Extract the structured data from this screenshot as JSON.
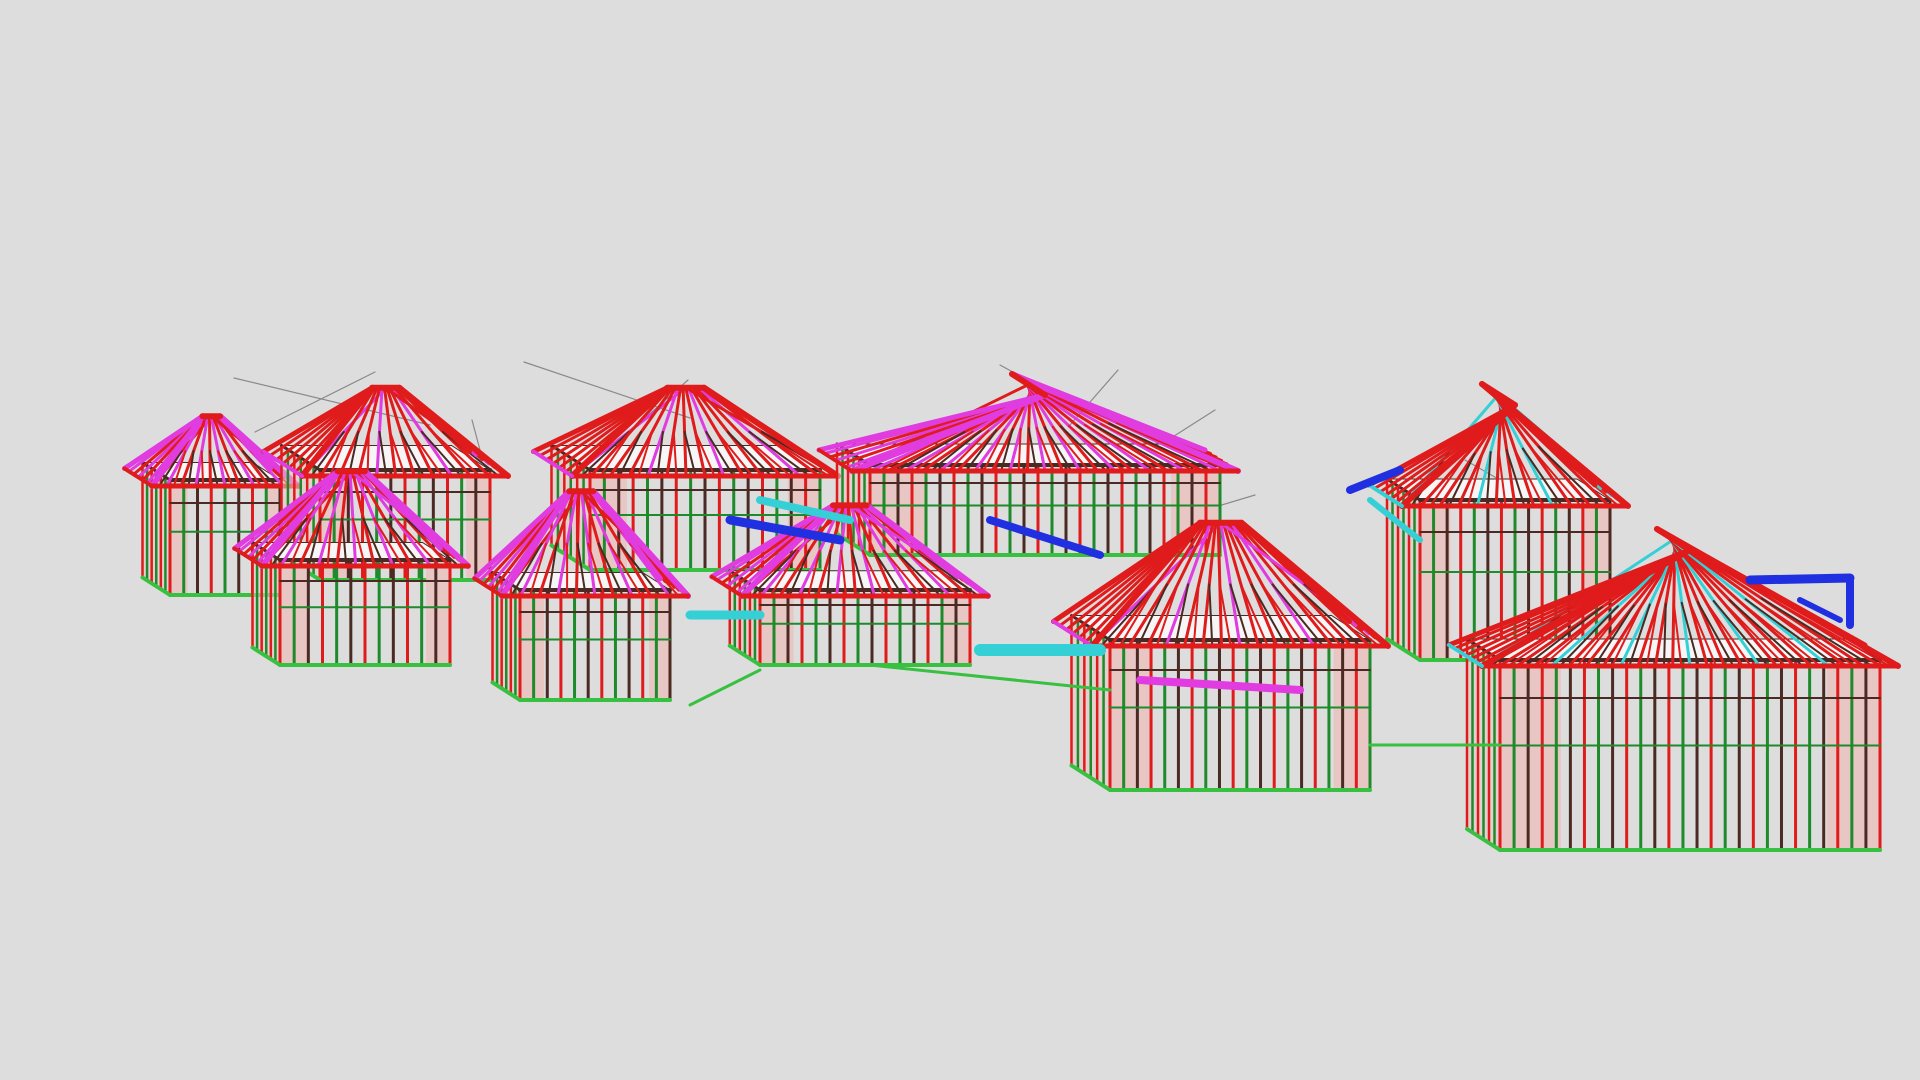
{
  "viewport": {
    "background_color": "#dddddd"
  },
  "model": {
    "colors": {
      "truss_red": "#e01b1b",
      "truss_magenta": "#e03ce0",
      "truss_cyan": "#35d0d6",
      "beam_blue": "#2030e0",
      "stud_green": "#1f8a2c",
      "plate_green": "#38c040",
      "frame_dark": "#4a2a22",
      "ceiling_white": "#f6f6f6",
      "wall_pink": "#e8c6c4",
      "guide_gray": "#8a8a8a"
    }
  }
}
